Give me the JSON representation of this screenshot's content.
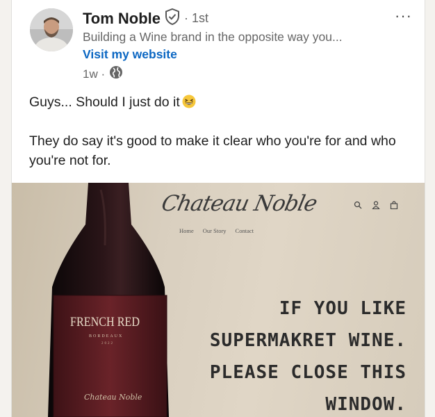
{
  "author": {
    "name": "Tom Noble",
    "degree": "· 1st",
    "headline": "Building a Wine brand in the opposite way you...",
    "website_link": "Visit my website",
    "time": "1w ·"
  },
  "post": {
    "line1": "Guys... Should I just do it",
    "line2": "They do say it's good to make it clear who you're for and who you're not for."
  },
  "image": {
    "brand": "Chateau Noble",
    "nav": [
      "Home",
      "Our Story",
      "Contact"
    ],
    "headline_lines": [
      "IF YOU LIKE",
      "SUPERMAKRET WINE.",
      "PLEASE CLOSE THIS",
      "WINDOW."
    ],
    "bottle_label_title": "FRENCH RED",
    "bottle_label_sub": "BORDEAUX",
    "bottle_label_year": "2022",
    "bottle_label_sign": "Chateau Noble"
  },
  "icons": [
    "verified-icon",
    "more-options-icon",
    "globe-icon",
    "grinning-squinting-emoji",
    "search-icon",
    "user-icon",
    "bag-icon"
  ],
  "colors": {
    "link": "#0a66c2",
    "bottle_label": "#5a1e24"
  }
}
